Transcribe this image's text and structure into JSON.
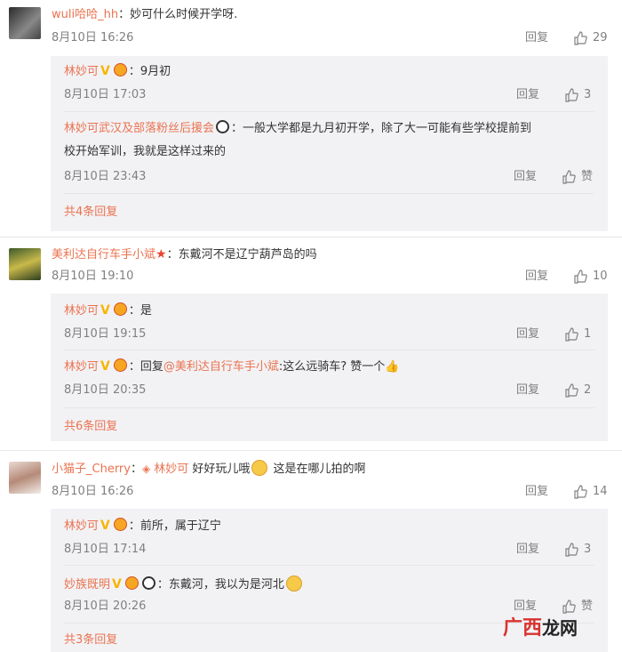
{
  "comments": [
    {
      "user": "wuli哈哈_hh",
      "text": "：妙可什么时候开学呀.",
      "time": "8月10日 16:26",
      "reply_label": "回复",
      "likes": "29",
      "replies": [
        {
          "user": "林妙可",
          "text": "：9月初",
          "time": "8月10日 17:03",
          "reply_label": "回复",
          "likes": "3"
        },
        {
          "user": "林妙可武汉及部落粉丝后援会",
          "text_line1": "：一般大学都是九月初开学，除了大一可能有些学校提前到",
          "text_line2": "校开始军训，我就是这样过来的",
          "time": "8月10日 23:43",
          "reply_label": "回复",
          "likes": "赞"
        }
      ],
      "more": "共4条回复"
    },
    {
      "user": "美利达自行车手小斌",
      "text": "：东戴河不是辽宁葫芦岛的吗",
      "time": "8月10日 19:10",
      "reply_label": "回复",
      "likes": "10",
      "replies": [
        {
          "user": "林妙可",
          "text": "：是",
          "time": "8月10日 19:15",
          "reply_label": "回复",
          "likes": "1"
        },
        {
          "user": "林妙可",
          "text_pre": "：回复",
          "mention": "@美利达自行车手小斌",
          "text_post": ":这么远骑车? 赞一个",
          "time": "8月10日 20:35",
          "reply_label": "回复",
          "likes": "2"
        }
      ],
      "more": "共6条回复"
    },
    {
      "user": "小猫子_Cherry",
      "text_pre": "：",
      "mention": "林妙可",
      "text_mid": " 好好玩儿哦",
      "text_post": " 这是在哪儿拍的啊",
      "time": "8月10日 16:26",
      "reply_label": "回复",
      "likes": "14",
      "replies": [
        {
          "user": "林妙可",
          "text": "：前所，属于辽宁",
          "time": "8月10日 17:14",
          "reply_label": "回复",
          "likes": "3"
        },
        {
          "user": "妙族既明",
          "text": "：东戴河，我以为是河北",
          "time": "8月10日 20:26",
          "reply_label": "回复",
          "likes": "赞"
        }
      ],
      "more": "共3条回复"
    }
  ],
  "watermark": {
    "part1": "广西",
    "part2": "龙网"
  },
  "icons": {
    "like": "thumb-up-icon",
    "verified": "verified-v-icon",
    "badge": "crown-badge-icon"
  }
}
